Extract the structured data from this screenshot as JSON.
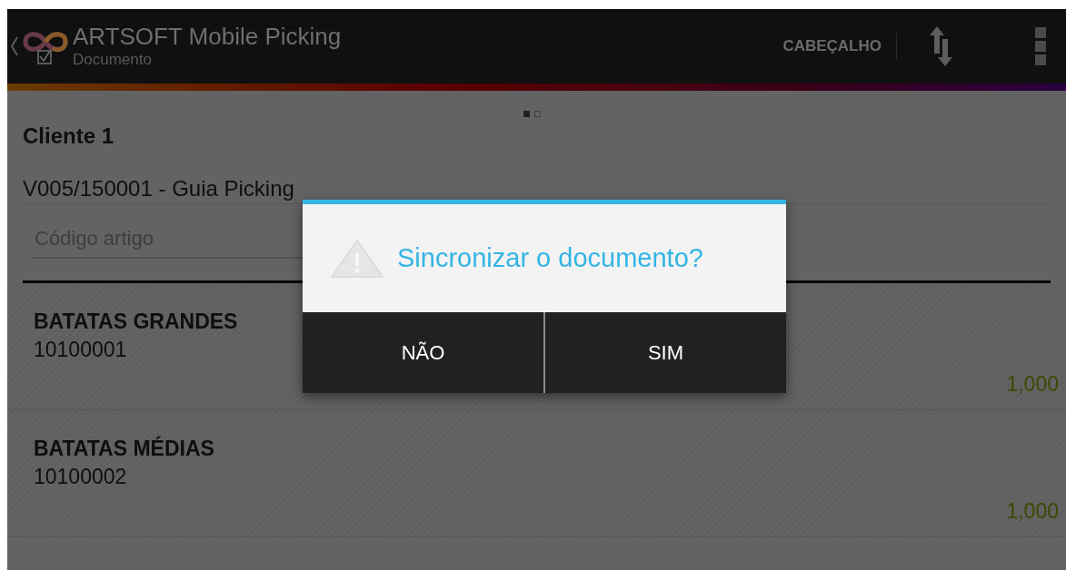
{
  "action_bar": {
    "title": "ARTSOFT Mobile Picking",
    "subtitle": "Documento",
    "action": "CABEÇALHO"
  },
  "pager": [
    {
      "selected": true
    },
    {
      "selected": false
    }
  ],
  "header": {
    "client": "Cliente 1",
    "document": "V005/150001 - Guia Picking"
  },
  "search": {
    "placeholder": "Código artigo"
  },
  "items": [
    {
      "name": "BATATAS GRANDES",
      "code": "10100001",
      "quantity": "1,000"
    },
    {
      "name": "BATATAS MÉDIAS",
      "code": "10100002",
      "quantity": "1,000"
    }
  ],
  "dialog": {
    "title": "Sincronizar o documento?",
    "buttons": [
      "NÃO",
      "SIM"
    ]
  }
}
